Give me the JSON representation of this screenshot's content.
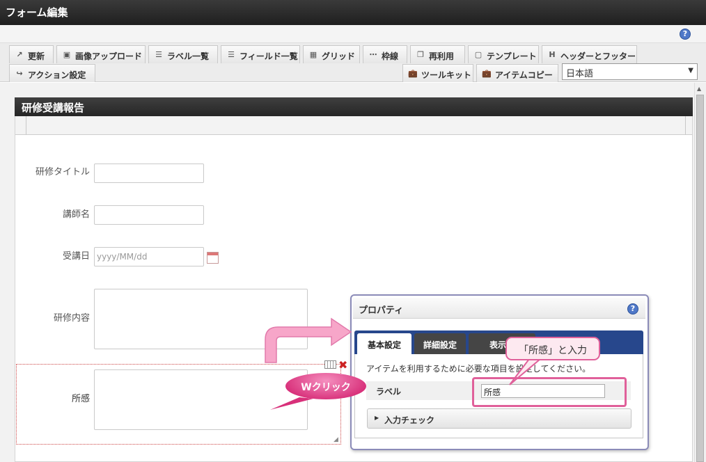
{
  "window": {
    "title": "フォーム編集"
  },
  "toolbar": {
    "row1": [
      {
        "label": "更新",
        "icon": "update-icon"
      },
      {
        "label": "画像アップロード",
        "icon": "image-upload-icon"
      },
      {
        "label": "ラベル一覧",
        "icon": "label-list-icon"
      },
      {
        "label": "フィールド一覧",
        "icon": "field-list-icon"
      },
      {
        "label": "グリッド",
        "icon": "grid-icon"
      },
      {
        "label": "枠線",
        "icon": "border-icon"
      },
      {
        "label": "再利用",
        "icon": "reuse-icon"
      },
      {
        "label": "テンプレート",
        "icon": "template-icon"
      },
      {
        "label": "ヘッダーとフッター",
        "icon": "header-footer-icon"
      }
    ],
    "row2": {
      "action": {
        "label": "アクション設定",
        "icon": "action-icon"
      },
      "toolkit": {
        "label": "ツールキット",
        "icon": "toolkit-icon"
      },
      "item_copy": {
        "label": "アイテムコピー",
        "icon": "toolbox-icon"
      }
    },
    "language": "日本語",
    "help_glyph": "?"
  },
  "form": {
    "title": "研修受講報告",
    "fields": [
      {
        "label": "研修タイトル",
        "value": ""
      },
      {
        "label": "講師名",
        "value": ""
      },
      {
        "label": "受講日",
        "placeholder": "yyyy/MM/dd"
      },
      {
        "label": "研修内容",
        "value": ""
      },
      {
        "label": "所感",
        "value": ""
      }
    ]
  },
  "properties": {
    "title": "プロパティ",
    "help_glyph": "?",
    "tabs": [
      "基本設定",
      "詳細設定",
      "表示ス"
    ],
    "description": "アイテムを利用するために必要な項目を設定してください。",
    "label_name": "ラベル",
    "label_value": "所感",
    "accordion": "入力チェック"
  },
  "annotations": {
    "callout": "「所感」と入力",
    "wclick": "Wクリック"
  },
  "colors": {
    "accent_pink": "#e0609a",
    "tab_blue": "#27478c",
    "title_dark": "#262626"
  }
}
